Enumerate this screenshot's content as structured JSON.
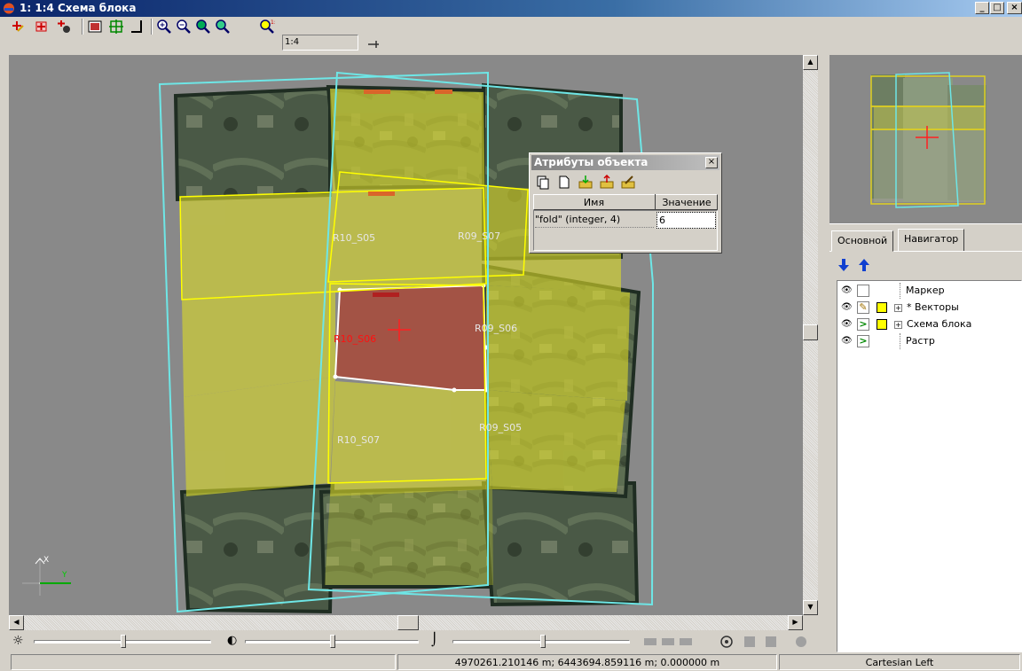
{
  "window": {
    "title": "1: 1:4 Схема блока",
    "min_label": "_",
    "max_label": "□",
    "close_label": "×"
  },
  "toolbar": {
    "scale_value": "1:4",
    "buttons": [
      "add-point-icon",
      "add-grid-icon",
      "add-marker-icon",
      "image-frame-icon",
      "crosshair-grid-icon",
      "corner-icon",
      "zoom-in-icon",
      "zoom-out-icon",
      "zoom-fit-icon",
      "zoom-window-icon",
      "zoom-scale-icon",
      "pin-icon"
    ]
  },
  "canvas": {
    "image_labels": [
      "R10_S05",
      "R09_S07",
      "R10_S06",
      "R09_S06",
      "R10_S07",
      "R09_S05"
    ],
    "axis_x": "X",
    "axis_y": "Y"
  },
  "attributes_dialog": {
    "title": "Атрибуты объекта",
    "close_label": "×",
    "col_name": "Имя",
    "col_value": "Значение",
    "rows": [
      {
        "name": "\"fold\" (integer, 4)",
        "value": "6"
      }
    ]
  },
  "right_panel": {
    "tabs": [
      "Основной",
      "Навигатор"
    ],
    "active_tab": "Основной",
    "layers": [
      {
        "label": "Маркер"
      },
      {
        "label": "* Векторы"
      },
      {
        "label": "Схема блока"
      },
      {
        "label": "Растр"
      }
    ]
  },
  "status": {
    "left": "",
    "coords": "4970261.210146 m; 6443694.859116 m; 0.000000 m",
    "projection": "Cartesian Left"
  },
  "colors": {
    "highlight_yellow": "#ffff00",
    "selected_red": "#c0392b",
    "footprint_cyan": "#6ee6e6",
    "canvas_bg": "#898989"
  }
}
